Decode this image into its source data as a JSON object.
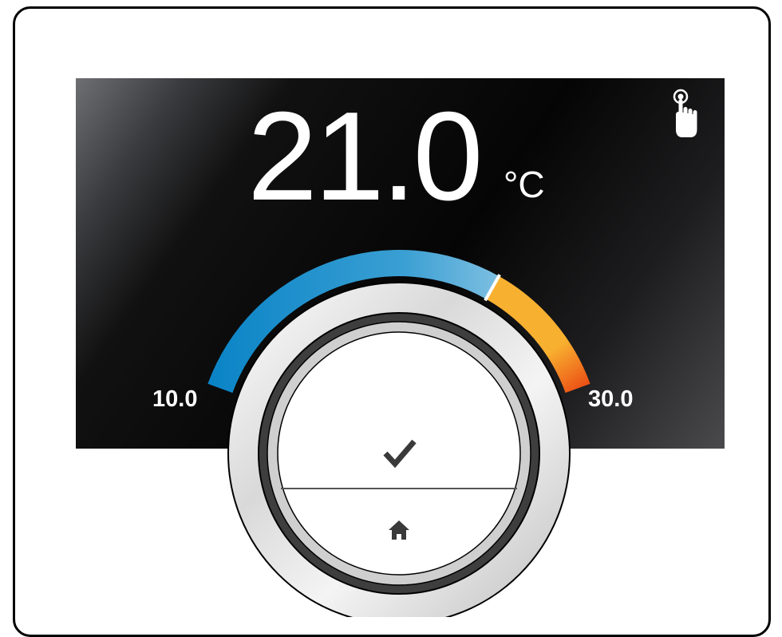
{
  "display": {
    "temperature": "21.0",
    "unit": "°C"
  },
  "scale": {
    "min_label": "10.0",
    "max_label": "30.0",
    "setpoint_fraction": 0.71
  },
  "icons": {
    "touch": "touch-hand-icon",
    "confirm": "checkmark-icon",
    "home": "home-icon"
  },
  "colors": {
    "arc_cold": "#0a84c6",
    "arc_light": "#a6d2ea",
    "arc_warm": "#f5a01e",
    "arc_hot": "#e83a0f"
  }
}
